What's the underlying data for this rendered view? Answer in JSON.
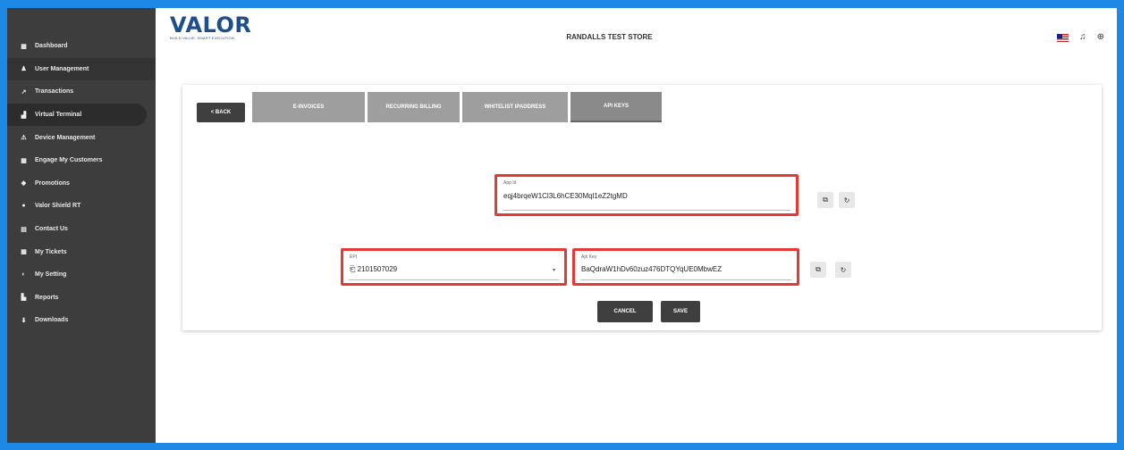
{
  "sidebar": {
    "items": [
      {
        "icon": "dashboard-icon",
        "glyph": "▦",
        "label": "Dashboard"
      },
      {
        "icon": "user-management-icon",
        "glyph": "♟",
        "label": "User Management"
      },
      {
        "icon": "transactions-icon",
        "glyph": "↗",
        "label": "Transactions"
      },
      {
        "icon": "virtual-terminal-icon",
        "glyph": "▟",
        "label": "Virtual Terminal"
      },
      {
        "icon": "device-management-icon",
        "glyph": "⚠",
        "label": "Device Management"
      },
      {
        "icon": "engage-customers-icon",
        "glyph": "▦",
        "label": "Engage My Customers"
      },
      {
        "icon": "promotions-icon",
        "glyph": "◆",
        "label": "Promotions"
      },
      {
        "icon": "shield-icon",
        "glyph": "●",
        "label": "Valor Shield RT"
      },
      {
        "icon": "contact-icon",
        "glyph": "▤",
        "label": "Contact Us"
      },
      {
        "icon": "tickets-icon",
        "glyph": "▦",
        "label": "My Tickets"
      },
      {
        "icon": "settings-icon",
        "glyph": "◐",
        "label": "My Setting"
      },
      {
        "icon": "reports-icon",
        "glyph": "▙",
        "label": "Reports"
      },
      {
        "icon": "downloads-icon",
        "glyph": "⬇",
        "label": "Downloads"
      }
    ]
  },
  "header": {
    "logo": "VALOR",
    "logo_tagline": "BUILD VALUE. SMART EXECUTION",
    "store_name": "RANDALLS TEST STORE"
  },
  "tabs": {
    "back": "< BACK",
    "items": [
      "E-INVOICES",
      "RECURRING BILLING",
      "WHITELIST IPADDRESS",
      "API KEYS"
    ]
  },
  "form": {
    "app_id": {
      "label": "App Id",
      "value": "eqj4brqeW1Cl3L6hCE30Mql1eZ2tgMD"
    },
    "epi": {
      "label": "EPI",
      "value": "2101507029"
    },
    "api_key": {
      "label": "Api Key",
      "value": "BaQdraW1hDv60zuz476DTQYqUE0MbwEZ"
    },
    "cancel": "CANCEL",
    "save": "SAVE"
  },
  "colors": {
    "accent_frame": "#1e88e5",
    "highlight": "#e53935",
    "sidebar_bg": "#3d3d3d",
    "brand": "#1f4e8c"
  }
}
